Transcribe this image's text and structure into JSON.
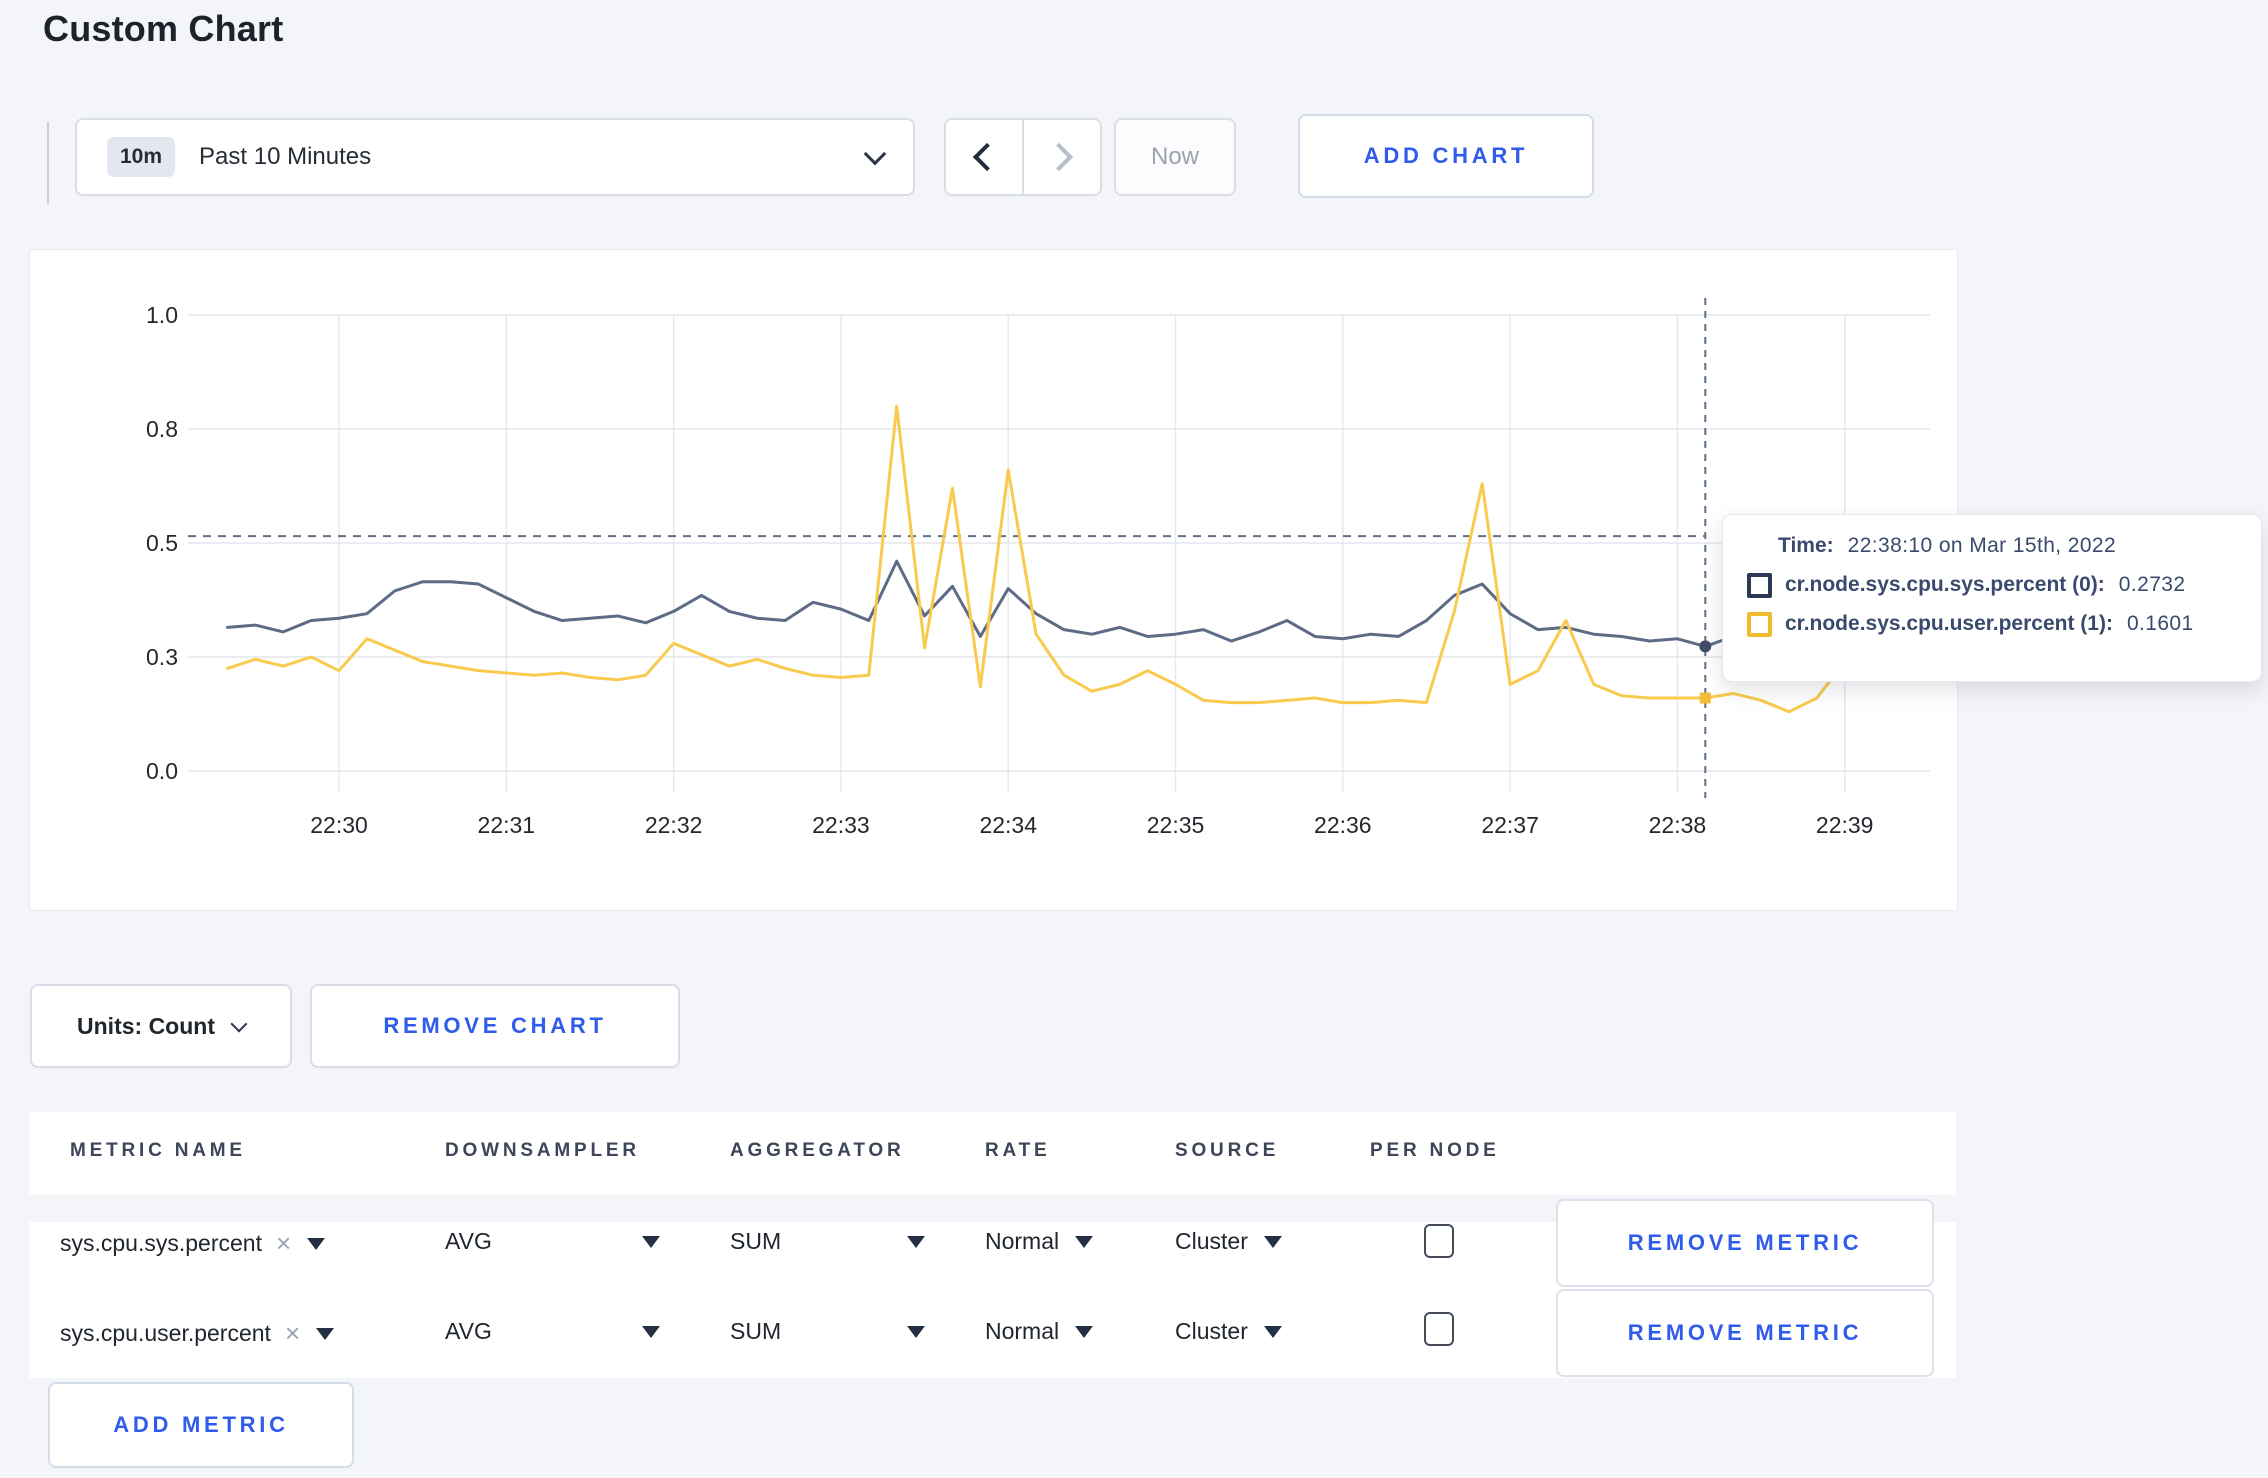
{
  "page": {
    "title": "Custom Chart"
  },
  "toolbar": {
    "time_range_badge": "10m",
    "time_range_label": "Past 10 Minutes",
    "prev_label": "previous-time-window",
    "next_label": "next-time-window",
    "now_label": "Now",
    "add_chart_label": "ADD CHART"
  },
  "chart_controls": {
    "units_label": "Units: Count",
    "remove_chart_label": "REMOVE CHART"
  },
  "tooltip": {
    "time_label": "Time:",
    "time_value": "22:38:10 on Mar 15th, 2022",
    "rows": [
      {
        "name": "cr.node.sys.cpu.sys.percent (0):",
        "value": "0.2732",
        "color": "#2c3a54"
      },
      {
        "name": "cr.node.sys.cpu.user.percent (1):",
        "value": "0.1601",
        "color": "#f0bc2e"
      }
    ]
  },
  "icons": {
    "close_x": "×"
  },
  "table": {
    "columns": [
      "METRIC NAME",
      "DOWNSAMPLER",
      "AGGREGATOR",
      "RATE",
      "SOURCE",
      "PER NODE"
    ],
    "rows": [
      {
        "metric": "sys.cpu.sys.percent",
        "downsampler": "AVG",
        "aggregator": "SUM",
        "rate": "Normal",
        "source": "Cluster",
        "per_node_checked": false,
        "remove_label": "REMOVE METRIC"
      },
      {
        "metric": "sys.cpu.user.percent",
        "downsampler": "AVG",
        "aggregator": "SUM",
        "rate": "Normal",
        "source": "Cluster",
        "per_node_checked": false,
        "remove_label": "REMOVE METRIC"
      }
    ],
    "add_metric_label": "ADD METRIC"
  },
  "chart_data": {
    "type": "line",
    "title": "",
    "xlabel": "",
    "ylabel": "",
    "x_start": "22:29:20",
    "interval_seconds": 10,
    "x_tick_labels": [
      "22:30",
      "22:31",
      "22:32",
      "22:33",
      "22:34",
      "22:35",
      "22:36",
      "22:37",
      "22:38",
      "22:39"
    ],
    "y_tick_labels": [
      "0.0",
      "0.3",
      "0.5",
      "0.8",
      "1.0"
    ],
    "y_tick_values": [
      0,
      0.25,
      0.5,
      0.75,
      1.0
    ],
    "ylim": [
      0,
      1
    ],
    "grid": true,
    "legend_position": "none",
    "series": [
      {
        "name": "cr.node.sys.cpu.sys.percent",
        "color": "#5d6b85",
        "values": [
          0.315,
          0.32,
          0.305,
          0.33,
          0.335,
          0.345,
          0.395,
          0.415,
          0.415,
          0.41,
          0.38,
          0.35,
          0.33,
          0.335,
          0.34,
          0.325,
          0.35,
          0.385,
          0.35,
          0.335,
          0.33,
          0.37,
          0.355,
          0.33,
          0.46,
          0.34,
          0.405,
          0.295,
          0.4,
          0.345,
          0.31,
          0.3,
          0.315,
          0.295,
          0.3,
          0.31,
          0.285,
          0.305,
          0.33,
          0.295,
          0.29,
          0.3,
          0.295,
          0.33,
          0.385,
          0.41,
          0.345,
          0.31,
          0.315,
          0.3,
          0.295,
          0.285,
          0.29,
          0.2732,
          0.295,
          0.29,
          0.3,
          0.295,
          0.31,
          0.33,
          0.335
        ]
      },
      {
        "name": "cr.node.sys.cpu.user.percent",
        "color": "#f8ca4e",
        "values": [
          0.225,
          0.245,
          0.23,
          0.25,
          0.22,
          0.29,
          0.265,
          0.24,
          0.23,
          0.22,
          0.215,
          0.21,
          0.215,
          0.205,
          0.2,
          0.21,
          0.28,
          0.255,
          0.23,
          0.245,
          0.225,
          0.21,
          0.205,
          0.21,
          0.8,
          0.27,
          0.62,
          0.185,
          0.66,
          0.3,
          0.21,
          0.175,
          0.19,
          0.22,
          0.19,
          0.155,
          0.15,
          0.15,
          0.155,
          0.16,
          0.15,
          0.15,
          0.155,
          0.15,
          0.35,
          0.63,
          0.19,
          0.22,
          0.33,
          0.19,
          0.165,
          0.16,
          0.16,
          0.1601,
          0.17,
          0.155,
          0.13,
          0.16,
          0.24,
          0.27,
          0.245
        ]
      }
    ],
    "crosshair": {
      "index": 53,
      "time": "22:38:10",
      "hline_value": 0.515
    }
  }
}
